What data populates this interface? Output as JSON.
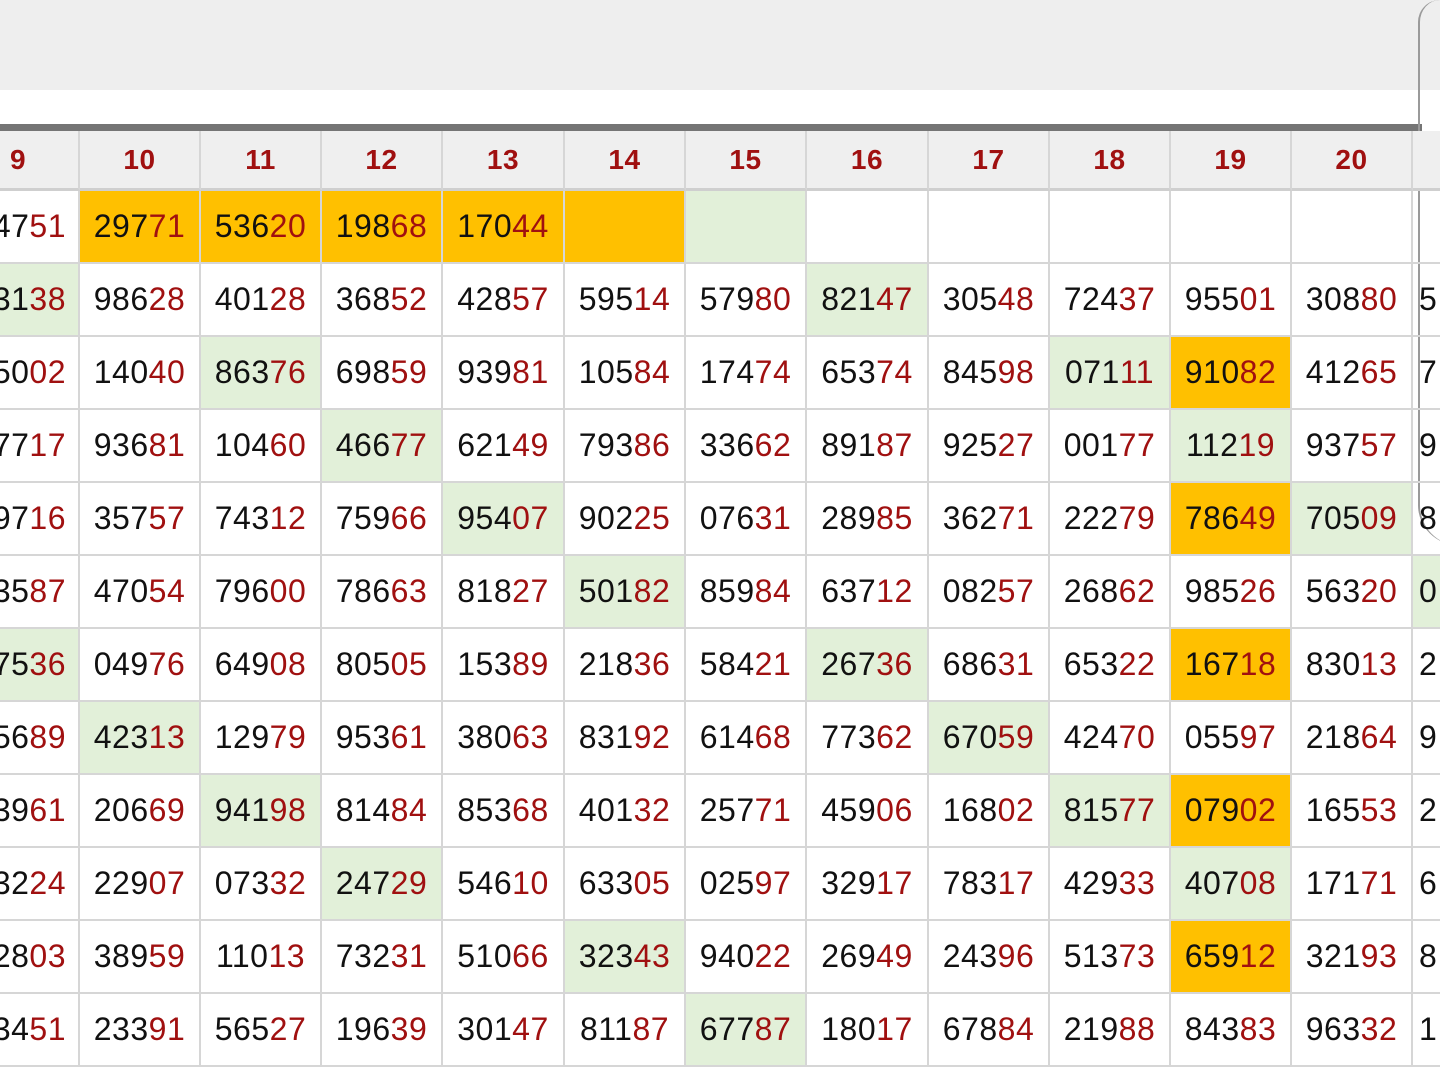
{
  "header": {
    "columns": [
      "9",
      "10",
      "11",
      "12",
      "13",
      "14",
      "15",
      "16",
      "17",
      "18",
      "19",
      "20",
      ""
    ]
  },
  "rows": [
    [
      {
        "h": "47",
        "t": "51"
      },
      {
        "h": "297",
        "t": "71",
        "bg": "o"
      },
      {
        "h": "536",
        "t": "20",
        "bg": "o"
      },
      {
        "h": "198",
        "t": "68",
        "bg": "o"
      },
      {
        "h": "170",
        "t": "44",
        "bg": "o"
      },
      {
        "h": "",
        "t": "",
        "bg": "o"
      },
      {
        "h": "",
        "t": "",
        "bg": "g"
      },
      {
        "h": "",
        "t": ""
      },
      {
        "h": "",
        "t": ""
      },
      {
        "h": "",
        "t": ""
      },
      {
        "h": "",
        "t": ""
      },
      {
        "h": "",
        "t": ""
      },
      {
        "h": "",
        "t": ""
      }
    ],
    [
      {
        "h": "31",
        "t": "38",
        "bg": "g"
      },
      {
        "h": "986",
        "t": "28"
      },
      {
        "h": "401",
        "t": "28"
      },
      {
        "h": "368",
        "t": "52"
      },
      {
        "h": "428",
        "t": "57"
      },
      {
        "h": "595",
        "t": "14"
      },
      {
        "h": "579",
        "t": "80"
      },
      {
        "h": "821",
        "t": "47",
        "bg": "g"
      },
      {
        "h": "305",
        "t": "48"
      },
      {
        "h": "724",
        "t": "37"
      },
      {
        "h": "955",
        "t": "01"
      },
      {
        "h": "308",
        "t": "80"
      },
      {
        "h": "5",
        "t": ""
      }
    ],
    [
      {
        "h": "50",
        "t": "02"
      },
      {
        "h": "140",
        "t": "40"
      },
      {
        "h": "863",
        "t": "76",
        "bg": "g"
      },
      {
        "h": "698",
        "t": "59"
      },
      {
        "h": "939",
        "t": "81"
      },
      {
        "h": "105",
        "t": "84"
      },
      {
        "h": "174",
        "t": "74"
      },
      {
        "h": "653",
        "t": "74"
      },
      {
        "h": "845",
        "t": "98"
      },
      {
        "h": "071",
        "t": "11",
        "bg": "g"
      },
      {
        "h": "910",
        "t": "82",
        "bg": "o"
      },
      {
        "h": "412",
        "t": "65"
      },
      {
        "h": "7",
        "t": ""
      }
    ],
    [
      {
        "h": "77",
        "t": "17"
      },
      {
        "h": "936",
        "t": "81"
      },
      {
        "h": "104",
        "t": "60"
      },
      {
        "h": "466",
        "t": "77",
        "bg": "g"
      },
      {
        "h": "621",
        "t": "49"
      },
      {
        "h": "793",
        "t": "86"
      },
      {
        "h": "336",
        "t": "62"
      },
      {
        "h": "891",
        "t": "87"
      },
      {
        "h": "925",
        "t": "27"
      },
      {
        "h": "001",
        "t": "77"
      },
      {
        "h": "112",
        "t": "19",
        "bg": "g"
      },
      {
        "h": "937",
        "t": "57"
      },
      {
        "h": "9",
        "t": ""
      }
    ],
    [
      {
        "h": "97",
        "t": "16"
      },
      {
        "h": "357",
        "t": "57"
      },
      {
        "h": "743",
        "t": "12"
      },
      {
        "h": "759",
        "t": "66"
      },
      {
        "h": "954",
        "t": "07",
        "bg": "g"
      },
      {
        "h": "902",
        "t": "25"
      },
      {
        "h": "076",
        "t": "31"
      },
      {
        "h": "289",
        "t": "85"
      },
      {
        "h": "362",
        "t": "71"
      },
      {
        "h": "222",
        "t": "79"
      },
      {
        "h": "786",
        "t": "49",
        "bg": "o"
      },
      {
        "h": "705",
        "t": "09",
        "bg": "g"
      },
      {
        "h": "8",
        "t": ""
      }
    ],
    [
      {
        "h": "35",
        "t": "87"
      },
      {
        "h": "470",
        "t": "54"
      },
      {
        "h": "796",
        "t": "00"
      },
      {
        "h": "786",
        "t": "63"
      },
      {
        "h": "818",
        "t": "27"
      },
      {
        "h": "501",
        "t": "82",
        "bg": "g"
      },
      {
        "h": "859",
        "t": "84"
      },
      {
        "h": "637",
        "t": "12"
      },
      {
        "h": "082",
        "t": "57"
      },
      {
        "h": "268",
        "t": "62"
      },
      {
        "h": "985",
        "t": "26"
      },
      {
        "h": "563",
        "t": "20"
      },
      {
        "h": "0",
        "t": "",
        "bg": "g"
      }
    ],
    [
      {
        "h": "75",
        "t": "36",
        "bg": "g"
      },
      {
        "h": "049",
        "t": "76"
      },
      {
        "h": "649",
        "t": "08"
      },
      {
        "h": "805",
        "t": "05"
      },
      {
        "h": "153",
        "t": "89"
      },
      {
        "h": "218",
        "t": "36"
      },
      {
        "h": "584",
        "t": "21"
      },
      {
        "h": "267",
        "t": "36",
        "bg": "g"
      },
      {
        "h": "686",
        "t": "31"
      },
      {
        "h": "653",
        "t": "22"
      },
      {
        "h": "167",
        "t": "18",
        "bg": "o"
      },
      {
        "h": "830",
        "t": "13"
      },
      {
        "h": "2",
        "t": ""
      }
    ],
    [
      {
        "h": "56",
        "t": "89"
      },
      {
        "h": "423",
        "t": "13",
        "bg": "g"
      },
      {
        "h": "129",
        "t": "79"
      },
      {
        "h": "953",
        "t": "61"
      },
      {
        "h": "380",
        "t": "63"
      },
      {
        "h": "831",
        "t": "92"
      },
      {
        "h": "614",
        "t": "68"
      },
      {
        "h": "773",
        "t": "62"
      },
      {
        "h": "670",
        "t": "59",
        "bg": "g"
      },
      {
        "h": "424",
        "t": "70"
      },
      {
        "h": "055",
        "t": "97"
      },
      {
        "h": "218",
        "t": "64"
      },
      {
        "h": "9",
        "t": ""
      }
    ],
    [
      {
        "h": "39",
        "t": "61"
      },
      {
        "h": "206",
        "t": "69"
      },
      {
        "h": "941",
        "t": "98",
        "bg": "g"
      },
      {
        "h": "814",
        "t": "84"
      },
      {
        "h": "853",
        "t": "68"
      },
      {
        "h": "401",
        "t": "32"
      },
      {
        "h": "257",
        "t": "71"
      },
      {
        "h": "459",
        "t": "06"
      },
      {
        "h": "168",
        "t": "02"
      },
      {
        "h": "815",
        "t": "77",
        "bg": "g"
      },
      {
        "h": "079",
        "t": "02",
        "bg": "o"
      },
      {
        "h": "165",
        "t": "53"
      },
      {
        "h": "2",
        "t": ""
      }
    ],
    [
      {
        "h": "32",
        "t": "24"
      },
      {
        "h": "229",
        "t": "07"
      },
      {
        "h": "073",
        "t": "32"
      },
      {
        "h": "247",
        "t": "29",
        "bg": "g"
      },
      {
        "h": "546",
        "t": "10"
      },
      {
        "h": "633",
        "t": "05"
      },
      {
        "h": "025",
        "t": "97"
      },
      {
        "h": "329",
        "t": "17"
      },
      {
        "h": "783",
        "t": "17"
      },
      {
        "h": "429",
        "t": "33"
      },
      {
        "h": "407",
        "t": "08",
        "bg": "g"
      },
      {
        "h": "171",
        "t": "71"
      },
      {
        "h": "6",
        "t": ""
      }
    ],
    [
      {
        "h": "28",
        "t": "03"
      },
      {
        "h": "389",
        "t": "59"
      },
      {
        "h": "110",
        "t": "13"
      },
      {
        "h": "732",
        "t": "31"
      },
      {
        "h": "510",
        "t": "66"
      },
      {
        "h": "323",
        "t": "43",
        "bg": "g"
      },
      {
        "h": "940",
        "t": "22"
      },
      {
        "h": "269",
        "t": "49"
      },
      {
        "h": "243",
        "t": "96"
      },
      {
        "h": "513",
        "t": "73"
      },
      {
        "h": "659",
        "t": "12",
        "bg": "o"
      },
      {
        "h": "321",
        "t": "93"
      },
      {
        "h": "8",
        "t": ""
      }
    ],
    [
      {
        "h": "34",
        "t": "51"
      },
      {
        "h": "233",
        "t": "91"
      },
      {
        "h": "565",
        "t": "27"
      },
      {
        "h": "196",
        "t": "39"
      },
      {
        "h": "301",
        "t": "47"
      },
      {
        "h": "811",
        "t": "87"
      },
      {
        "h": "677",
        "t": "87",
        "bg": "g"
      },
      {
        "h": "180",
        "t": "17"
      },
      {
        "h": "678",
        "t": "84"
      },
      {
        "h": "219",
        "t": "88"
      },
      {
        "h": "843",
        "t": "83"
      },
      {
        "h": "963",
        "t": "32"
      },
      {
        "h": "1",
        "t": ""
      }
    ]
  ]
}
